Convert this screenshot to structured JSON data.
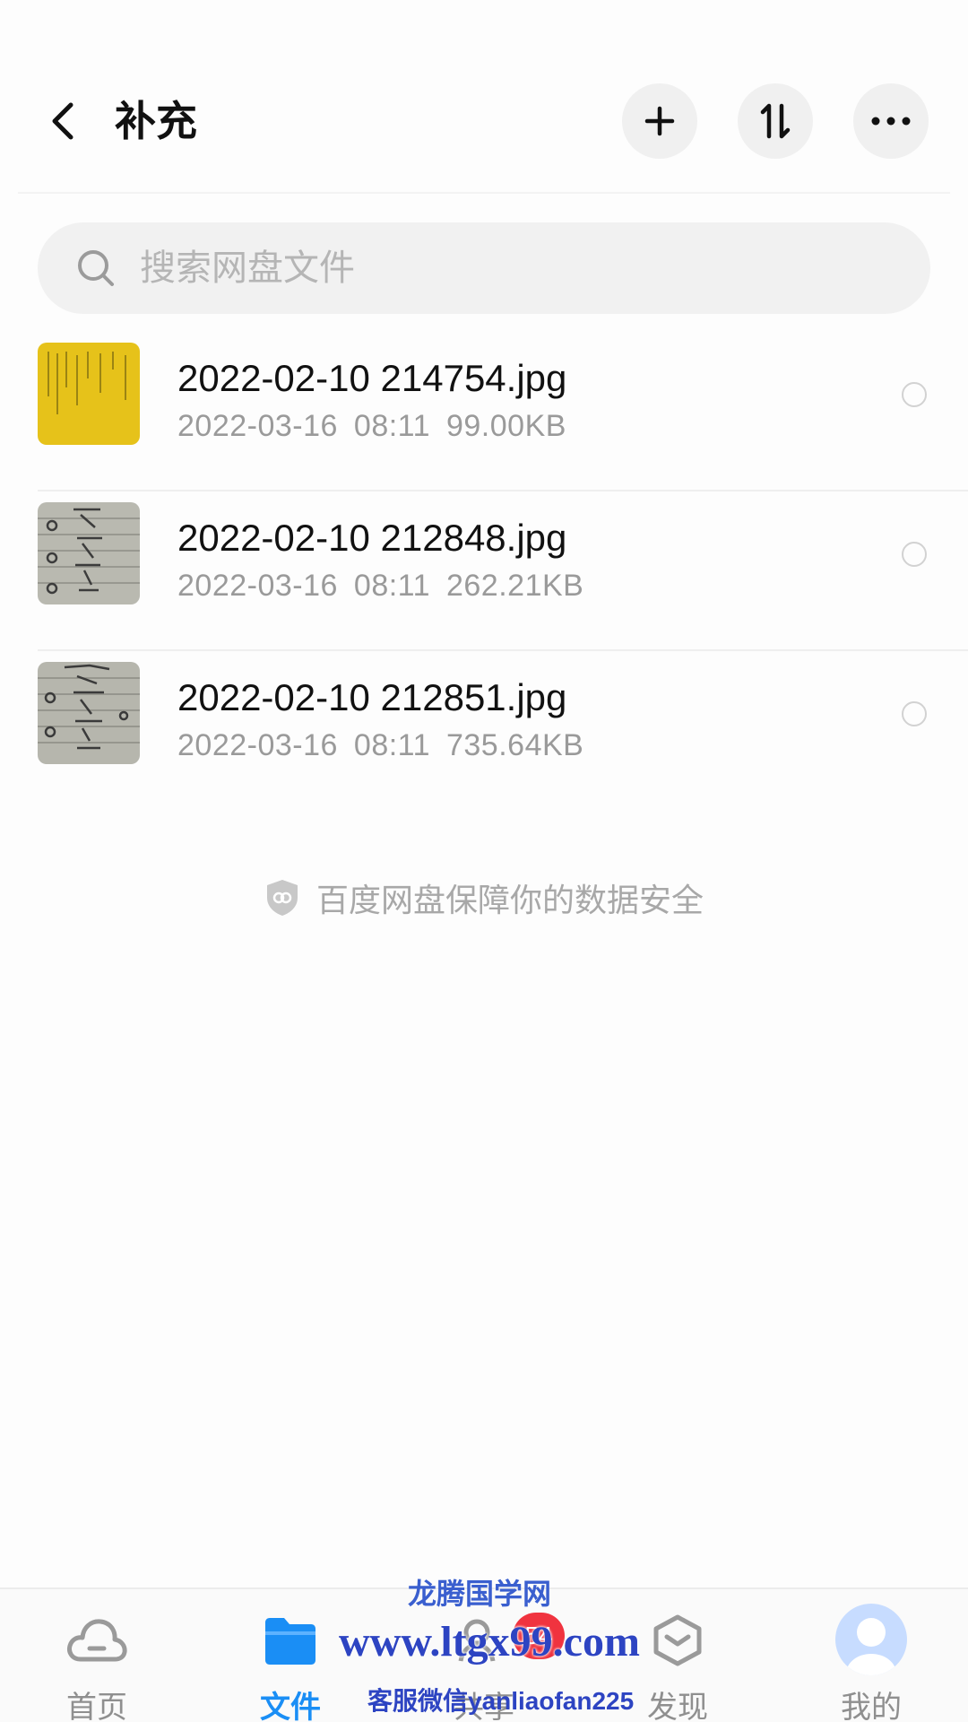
{
  "header": {
    "title": "补充",
    "back_icon": "chevron-left-icon",
    "actions": [
      {
        "icon": "plus-icon"
      },
      {
        "icon": "sort-icon"
      },
      {
        "icon": "more-icon"
      }
    ]
  },
  "search": {
    "placeholder": "搜索网盘文件",
    "icon": "search-icon"
  },
  "files": [
    {
      "name": "2022-02-10 214754.jpg",
      "date": "2022-03-16",
      "time": "08:11",
      "size": "99.00KB",
      "thumb_color": "#e6c21a"
    },
    {
      "name": "2022-02-10 212848.jpg",
      "date": "2022-03-16",
      "time": "08:11",
      "size": "262.21KB",
      "thumb_color": "#b9b9b0"
    },
    {
      "name": "2022-02-10 212851.jpg",
      "date": "2022-03-16",
      "time": "08:11",
      "size": "735.64KB",
      "thumb_color": "#b6b6ad"
    }
  ],
  "security_note": "百度网盘保障你的数据安全",
  "bottom_nav": [
    {
      "label": "首页",
      "icon": "cloud-icon",
      "active": false
    },
    {
      "label": "文件",
      "icon": "folder-icon",
      "active": true
    },
    {
      "label": "共享",
      "icon": "share-icon",
      "active": false,
      "badge": "54"
    },
    {
      "label": "发现",
      "icon": "discover-icon",
      "active": false
    },
    {
      "label": "我的",
      "icon": "avatar-icon",
      "active": false
    }
  ],
  "watermark": {
    "line1": "龙腾国学网",
    "line2": "www.ltgx99.com",
    "line3": "客服微信yanliaofan225"
  },
  "colors": {
    "accent": "#1a8ef5",
    "badge": "#f0333f",
    "watermark": "#2d44c2"
  }
}
